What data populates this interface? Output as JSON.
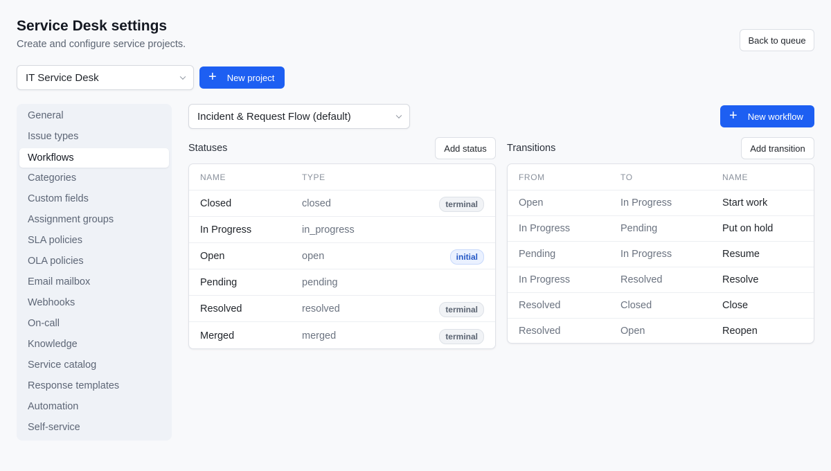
{
  "header": {
    "title": "Service Desk settings",
    "subtitle": "Create and configure service projects.",
    "back_label": "Back to queue"
  },
  "project": {
    "selected": "IT Service Desk",
    "new_label": "New project"
  },
  "sidebar": {
    "items": [
      {
        "label": "General",
        "active": false
      },
      {
        "label": "Issue types",
        "active": false
      },
      {
        "label": "Workflows",
        "active": true
      },
      {
        "label": "Categories",
        "active": false
      },
      {
        "label": "Custom fields",
        "active": false
      },
      {
        "label": "Assignment groups",
        "active": false
      },
      {
        "label": "SLA policies",
        "active": false
      },
      {
        "label": "OLA policies",
        "active": false
      },
      {
        "label": "Email mailbox",
        "active": false
      },
      {
        "label": "Webhooks",
        "active": false
      },
      {
        "label": "On-call",
        "active": false
      },
      {
        "label": "Knowledge",
        "active": false
      },
      {
        "label": "Service catalog",
        "active": false
      },
      {
        "label": "Response templates",
        "active": false
      },
      {
        "label": "Automation",
        "active": false
      },
      {
        "label": "Self-service",
        "active": false
      }
    ]
  },
  "workflow": {
    "selected": "Incident & Request Flow (default)",
    "new_label": "New workflow"
  },
  "statuses": {
    "title": "Statuses",
    "add_label": "Add status",
    "columns": [
      "NAME",
      "TYPE"
    ],
    "rows": [
      {
        "name": "Closed",
        "type": "closed",
        "badge": "terminal"
      },
      {
        "name": "In Progress",
        "type": "in_progress",
        "badge": ""
      },
      {
        "name": "Open",
        "type": "open",
        "badge": "initial"
      },
      {
        "name": "Pending",
        "type": "pending",
        "badge": ""
      },
      {
        "name": "Resolved",
        "type": "resolved",
        "badge": "terminal"
      },
      {
        "name": "Merged",
        "type": "merged",
        "badge": "terminal"
      }
    ]
  },
  "transitions": {
    "title": "Transitions",
    "add_label": "Add transition",
    "columns": [
      "FROM",
      "TO",
      "NAME"
    ],
    "rows": [
      {
        "from": "Open",
        "to": "In Progress",
        "name": "Start work"
      },
      {
        "from": "In Progress",
        "to": "Pending",
        "name": "Put on hold"
      },
      {
        "from": "Pending",
        "to": "In Progress",
        "name": "Resume"
      },
      {
        "from": "In Progress",
        "to": "Resolved",
        "name": "Resolve"
      },
      {
        "from": "Resolved",
        "to": "Closed",
        "name": "Close"
      },
      {
        "from": "Resolved",
        "to": "Open",
        "name": "Reopen"
      }
    ]
  },
  "colors": {
    "primary": "#1d5ff2",
    "background": "#f8f9fb",
    "sidebar": "#eff2f7"
  }
}
